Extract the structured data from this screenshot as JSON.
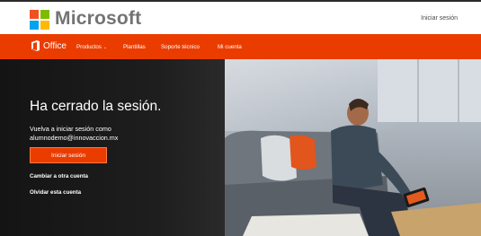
{
  "header": {
    "brand": "Microsoft",
    "sign_in": "Iniciar sesión",
    "logo_colors": [
      "#f25022",
      "#7fba00",
      "#00a4ef",
      "#ffb900"
    ]
  },
  "nav": {
    "product": "Office",
    "items": [
      "Productos",
      "Plantillas",
      "Soporte técnico",
      "Mi cuenta"
    ],
    "accent": "#eb3c00"
  },
  "hero": {
    "title": "Ha cerrado la sesión.",
    "line1": "Vuelva a iniciar sesión como",
    "account": "alumnodemo@innovaccion.mx",
    "button": "Iniciar sesión",
    "link_switch": "Cambiar a otra cuenta",
    "link_forget": "Olvidar esta cuenta"
  }
}
